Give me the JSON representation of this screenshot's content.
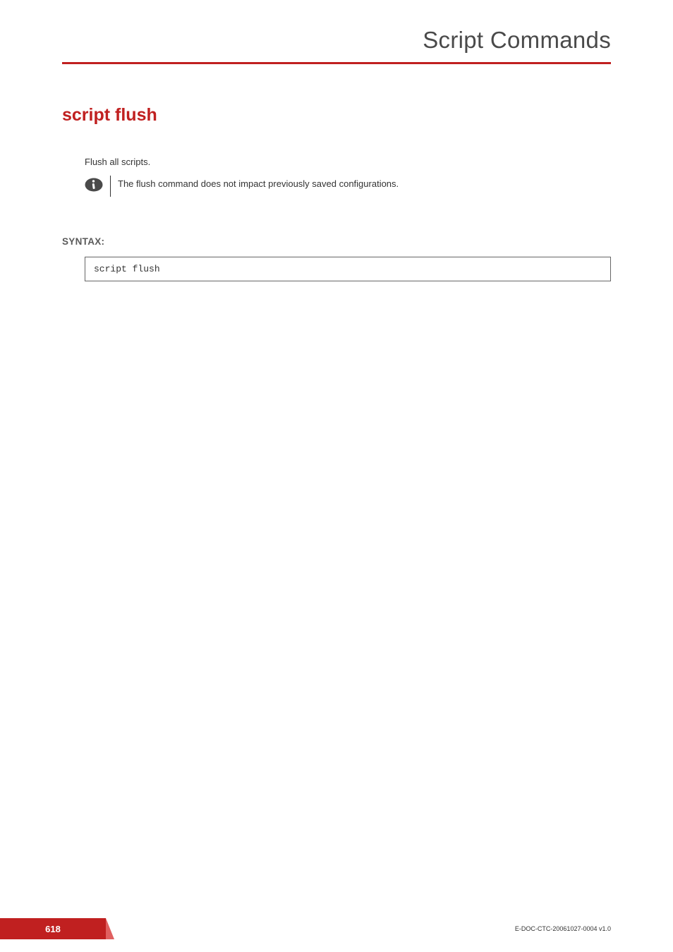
{
  "header": {
    "title": "Script Commands"
  },
  "command": {
    "title": "script flush",
    "description": "Flush all scripts.",
    "info_note": "The flush command does not impact previously saved configurations."
  },
  "syntax": {
    "label": "SYNTAX:",
    "code": "script flush"
  },
  "footer": {
    "page_number": "618",
    "doc_id": "E-DOC-CTC-20061027-0004 v1.0"
  }
}
